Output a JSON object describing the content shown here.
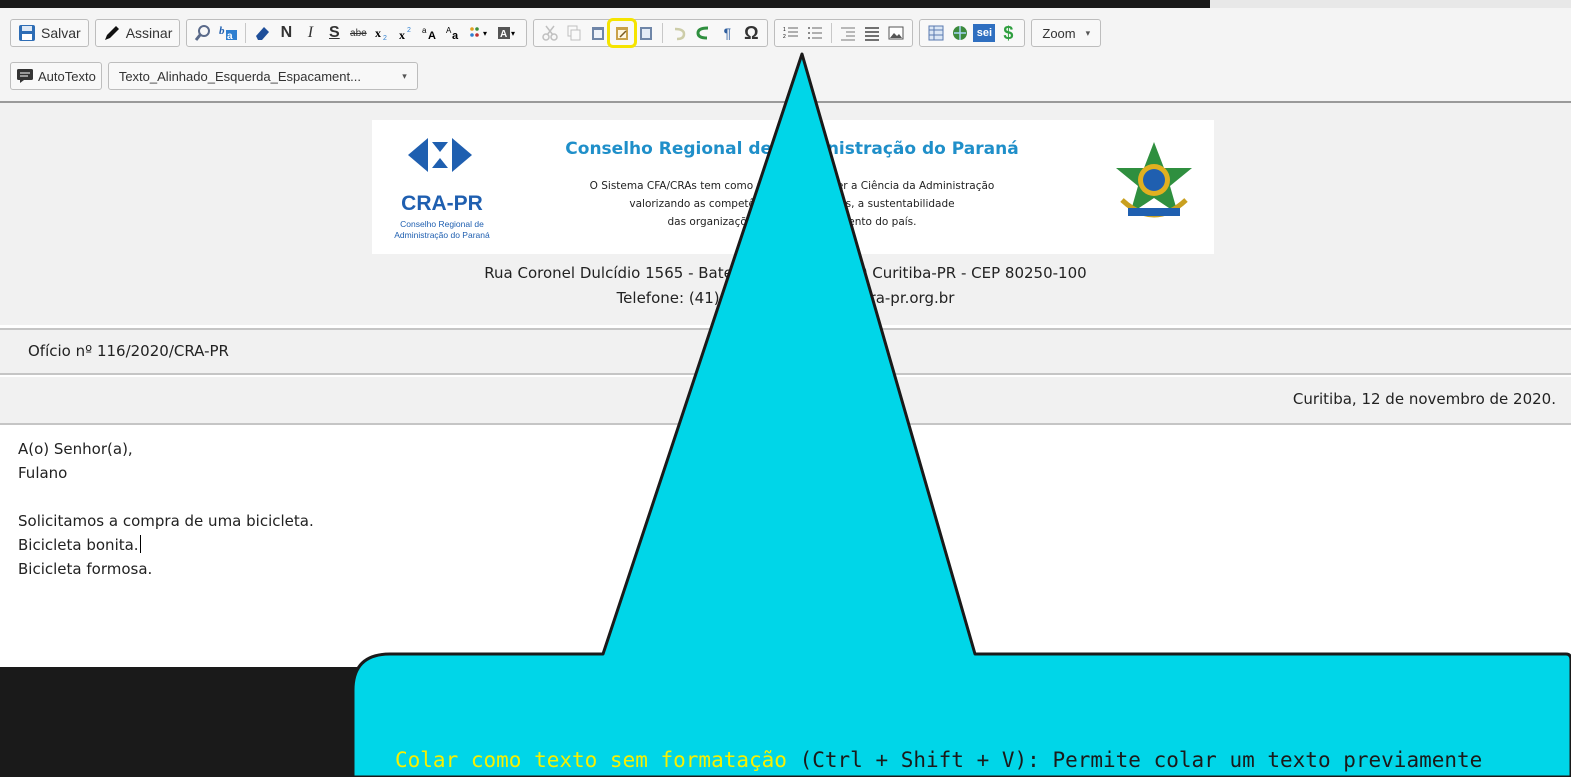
{
  "toolbar": {
    "save_label": "Salvar",
    "sign_label": "Assinar",
    "autotext_label": "AutoTexto",
    "style_value": "Texto_Alinhado_Esquerda_Espacament...",
    "zoom_label": "Zoom",
    "bold_glyph": "N",
    "italic_glyph": "I",
    "underline_glyph": "S",
    "omega_glyph": "Ω",
    "pilcrow_glyph": "¶",
    "sei_label": "sei",
    "dollar_glyph": "$",
    "strike_glyph": "abe",
    "highlighted_button": "paste-as-plain-text-button",
    "highlight_color": "#f5e400"
  },
  "letterhead": {
    "org_name": "Conselho Regional de Administração do Paraná",
    "mission_line1": "O Sistema CFA/CRAs tem como missão promover a Ciência da Administração",
    "mission_line2": "valorizando as competências profissionais, a sustentabilidade",
    "mission_line3": "das organizações e o desenvolvimento do país.",
    "logo_acronym": "CRA-PR",
    "logo_sub1": "Conselho Regional de",
    "logo_sub2": "Administração do Paraná",
    "brand_color": "#1f8fc9",
    "logo_color": "#1f5fb0"
  },
  "document": {
    "address_line": "Rua Coronel Dulcídio 1565 - Batel - CEP 80250-100 Curitiba-PR - CEP 80250-100",
    "phone_line": "Telefone: (41) 3311-2500 - www.cra-pr.org.br",
    "oficio": "Ofício nº 116/2020/CRA-PR",
    "date_line": "Curitiba, 12 de novembro de 2020.",
    "body_lines": [
      "A(o) Senhor(a),",
      "Fulano",
      "",
      "Solicitamos a compra de uma bicicleta.",
      "Bicicleta bonita.",
      "Bicicleta formosa."
    ]
  },
  "callout": {
    "feature_name": "Colar como texto sem formatação",
    "description": " (Ctrl + Shift + V): Permite colar um texto previamente",
    "fill_color": "#00d6e8",
    "highlight_text_color": "#f7f000"
  }
}
